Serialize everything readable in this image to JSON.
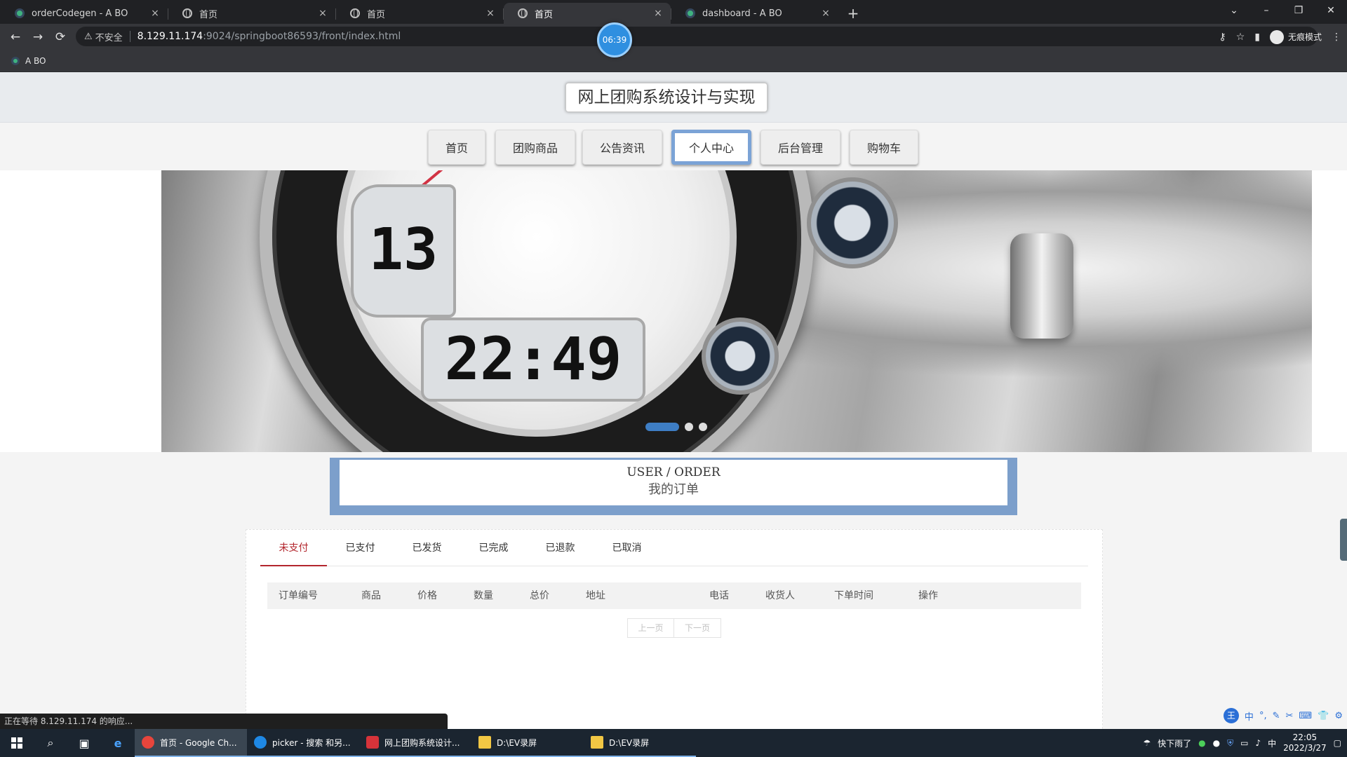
{
  "browser": {
    "tabs": [
      {
        "title": "orderCodegen - A BO",
        "favicon": "vue-icon",
        "active": false
      },
      {
        "title": "首页",
        "favicon": "globe-icon",
        "active": false
      },
      {
        "title": "首页",
        "favicon": "globe-icon",
        "active": false
      },
      {
        "title": "首页",
        "favicon": "globe-icon",
        "active": true
      },
      {
        "title": "dashboard - A BO",
        "favicon": "vue-icon",
        "active": false
      }
    ],
    "new_tab": "+",
    "close_glyph": "×",
    "window_controls": {
      "tab_search": "⌄",
      "minimize": "–",
      "restore": "❐",
      "close": "✕"
    },
    "nav": {
      "back": "←",
      "forward": "→",
      "reload": "⟳"
    },
    "security_icon": "⚠",
    "security_label": "不安全",
    "url_host": "8.129.11.174",
    "url_path": ":9024/springboot86593/front/index.html",
    "toolbar_icons": {
      "key": "⚷",
      "star": "☆",
      "sidepanel": "▮"
    },
    "incognito_label": "无痕模式",
    "menu": "⋮",
    "bookmark": "A BO",
    "recording_timer": "06:39",
    "status_text": "正在等待 8.129.11.174 的响应..."
  },
  "site": {
    "title": "网上团购系统设计与实现",
    "nav": [
      {
        "label": "首页",
        "active": false
      },
      {
        "label": "团购商品",
        "active": false
      },
      {
        "label": "公告资讯",
        "active": false
      },
      {
        "label": "个人中心",
        "active": true
      },
      {
        "label": "后台管理",
        "active": false
      },
      {
        "label": "购物车",
        "active": false
      }
    ],
    "banner": {
      "lcd_main": "22:49",
      "lcd_side": "13",
      "slides": 3,
      "active_slide": 1
    },
    "order_title_en": "USER / ORDER",
    "order_title_cn": "我的订单",
    "order_tabs": [
      "未支付",
      "已支付",
      "已发货",
      "已完成",
      "已退款",
      "已取消"
    ],
    "active_order_tab": 0,
    "table_headers": [
      "订单编号",
      "商品",
      "价格",
      "数量",
      "总价",
      "地址",
      "电话",
      "收货人",
      "下单时间",
      "操作"
    ],
    "pager": {
      "prev": "上一页",
      "next": "下一页"
    }
  },
  "ime": {
    "logo": "王",
    "items": [
      "中",
      "°,",
      "✎",
      "✂",
      "⌨",
      "👕",
      "⚙"
    ]
  },
  "taskbar": {
    "apps": [
      {
        "label": "首页 - Google Ch...",
        "icon_color": "#e8453c",
        "state": "active"
      },
      {
        "label": "picker - 搜索 和另...",
        "icon_color": "#1e88e5",
        "state": "open"
      },
      {
        "label": "网上团购系统设计...",
        "icon_color": "#d6333a",
        "state": "open"
      },
      {
        "label": "D:\\EV录屏",
        "icon_color": "#f2c744",
        "state": "open"
      },
      {
        "label": "D:\\EV录屏",
        "icon_color": "#f2c744",
        "state": "open"
      }
    ],
    "weather": "快下雨了",
    "ime_indicator": "中",
    "time": "22:05",
    "date": "2022/3/27"
  }
}
